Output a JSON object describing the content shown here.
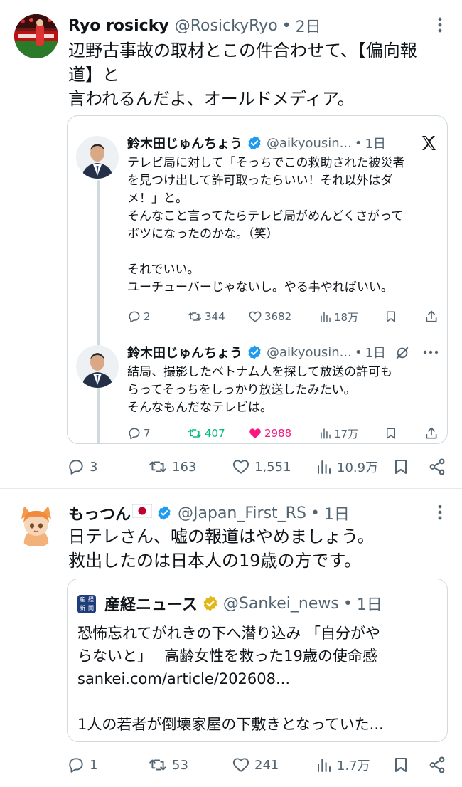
{
  "post1": {
    "name": "Ryo rosicky",
    "handle": "@RosickyRyo",
    "sep": "•",
    "time": "2日",
    "text_line1": "辺野古事故の取材とこの件合わせて、【偏向報",
    "text_line2": "道】と",
    "text_line3": "言われるんだよ、オールドメディア。",
    "quote": {
      "first": {
        "name": "鈴木田じゅんちょう",
        "handle": "@aikyousin...",
        "sep": "•",
        "time": "1日",
        "lines": [
          "テレビ局に対して「そっちでこの救助された被災者",
          "を見つけ出して許可取ったらいい！それ以外はダ",
          "メ！」と。",
          "そんなこと言ってたらテレビ局がめんどくさがって",
          "ボツになったのかな。（笑）",
          "",
          "それでいい。",
          "ユーチューバーじゃないし。やる事やればいい。"
        ],
        "replies": "2",
        "reposts": "344",
        "likes": "3682",
        "views": "18万"
      },
      "second": {
        "name": "鈴木田じゅんちょう",
        "handle": "@aikyousin...",
        "sep": "•",
        "time": "1日",
        "lines": [
          "結局、撮影したベトナム人を探して放送の許可も",
          "らってそっちをしっかり放送したみたい。",
          "そんなもんだなテレビは。"
        ],
        "replies": "7",
        "reposts": "407",
        "likes": "2988",
        "views": "17万"
      }
    },
    "replies": "3",
    "reposts": "163",
    "likes": "1,551",
    "views": "10.9万"
  },
  "post2": {
    "name": "もっつん",
    "handle": "@Japan_First_RS",
    "sep": "•",
    "time": "1日",
    "text_line1": "日テレさん、嘘の報道はやめましょう。",
    "text_line2": "救出したのは日本人の19歳の方です。",
    "quote": {
      "name": "産経ニュース",
      "handle": "@Sankei_news",
      "sep": "•",
      "time": "1日",
      "logo_chars": [
        "産",
        "経",
        "新",
        "聞"
      ],
      "line1": "恐怖忘れてがれきの下へ潜り込み 「自分がや",
      "line2": "らないと」　 高齢女性を救った19歳の使命感",
      "link": "sankei.com/article/202608...",
      "line4": "1人の若者が倒壊家屋の下敷きとなっていた..."
    },
    "replies": "1",
    "reposts": "53",
    "likes": "241",
    "views": "1.7万"
  },
  "colors": {
    "text": "#0f1419",
    "muted": "#536471",
    "verified_blue": "#1d9bf0",
    "verified_gold": "#e2b719",
    "repost_green": "#00ba7c",
    "like_pink": "#f91880",
    "border": "#cfd9de"
  }
}
